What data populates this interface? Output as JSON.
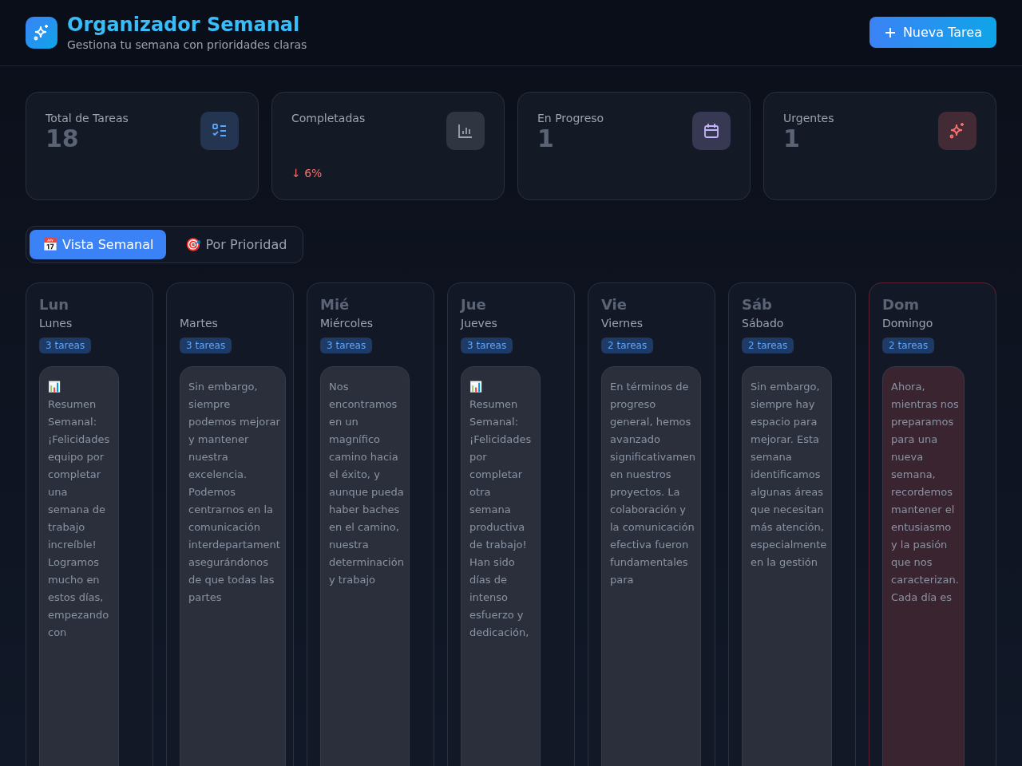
{
  "header": {
    "title": "Organizador Semanal",
    "subtitle": "Gestiona tu semana con prioridades claras",
    "new_button": "Nueva Tarea"
  },
  "stats": [
    {
      "label": "Total de Tareas",
      "value": "18",
      "color": "#60a5fa"
    },
    {
      "label": "Completadas",
      "trend": "↓ 6%",
      "color": "#9ca3af"
    },
    {
      "label": "En Progreso",
      "value": "1",
      "color": "#c4b5fd"
    },
    {
      "label": "Urgentes",
      "value": "1",
      "color": "#f87171"
    }
  ],
  "tabs": [
    {
      "label": "📅 Vista Semanal",
      "selected": true
    },
    {
      "label": "🎯 Por Prioridad",
      "selected": false
    }
  ],
  "days": [
    {
      "abbr": "Lun",
      "name": "Lunes",
      "count": "3 tareas",
      "highlighted": false,
      "task": "📊 Resumen Semanal: ¡Felicidades equipo por completar una semana de trabajo increíble! Logramos mucho en estos días, empezando con"
    },
    {
      "name": "Martes",
      "count": "3 tareas",
      "highlighted": false,
      "task": "Sin embargo, siempre podemos mejorar y mantener nuestra excelencia. Podemos centrarnos en la comunicación interdepartament asegurándonos de que todas las partes"
    },
    {
      "abbr": "Mié",
      "name": "Miércoles",
      "count": "3 tareas",
      "highlighted": false,
      "task": "Nos encontramos en un magnífico camino hacia el éxito, y aunque pueda haber baches en el camino, nuestra determinación y trabajo"
    },
    {
      "abbr": "Jue",
      "name": "Jueves",
      "count": "3 tareas",
      "highlighted": false,
      "task": "📊 Resumen Semanal: ¡Felicidades por completar otra semana productiva de trabajo! Han sido días de intenso esfuerzo y dedicación,"
    },
    {
      "abbr": "Vie",
      "name": "Viernes",
      "count": "2 tareas",
      "highlighted": false,
      "task": "En términos de progreso general, hemos avanzado significativamen en nuestros proyectos. La colaboración y la comunicación efectiva fueron fundamentales para"
    },
    {
      "abbr": "Sáb",
      "name": "Sábado",
      "count": "2 tareas",
      "highlighted": false,
      "task": "Sin embargo, siempre hay espacio para mejorar. Esta semana identificamos algunas áreas que necesitan más atención, especialmente en la gestión"
    },
    {
      "abbr": "Dom",
      "name": "Domingo",
      "count": "2 tareas",
      "highlighted": true,
      "task": "Ahora, mientras nos preparamos para una nueva semana, recordemos mantener el entusiasmo y la pasión que nos caracterizan. Cada día es"
    }
  ]
}
